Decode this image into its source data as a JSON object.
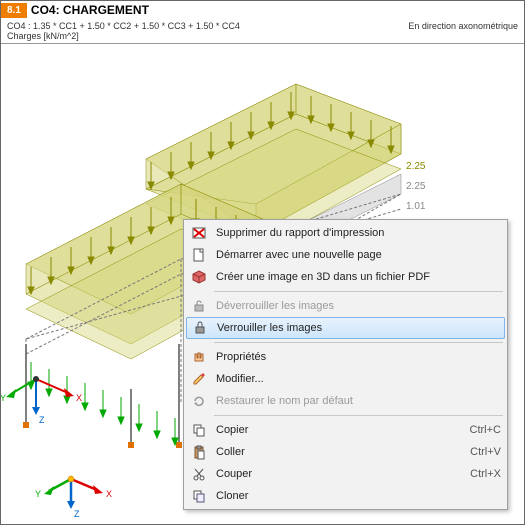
{
  "header": {
    "tag": "8.1",
    "title": "CO4: CHARGEMENT"
  },
  "subheader": {
    "formula": "CO4 : 1.35 * CC1 + 1.50 * CC2 + 1.50 * CC3 + 1.50 * CC4",
    "units": "Charges [kN/m^2]",
    "view_mode": "En direction axonométrique"
  },
  "loads": {
    "upper_right_1": "2.25",
    "upper_right_2": "2.25",
    "lower_right": "1.01"
  },
  "axis_large": {
    "x": "X",
    "y": "Y",
    "z": "Z"
  },
  "axis_small": {
    "x": "X",
    "y": "Y",
    "z": "Z"
  },
  "menu": {
    "delete_report": "Supprimer du rapport d'impression",
    "new_page": "Démarrer avec une nouvelle page",
    "create_3d_pdf": "Créer une image en 3D dans un fichier PDF",
    "unlock_images": "Déverrouiller les images",
    "lock_images": "Verrouiller les images",
    "properties": "Propriétés",
    "modify": "Modifier...",
    "restore_name": "Restaurer le nom par défaut",
    "copy": "Copier",
    "paste": "Coller",
    "cut": "Couper",
    "clone": "Cloner",
    "shortcut_copy": "Ctrl+C",
    "shortcut_paste": "Ctrl+V",
    "shortcut_cut": "Ctrl+X"
  },
  "icons": {
    "delete": "delete-icon",
    "page": "page-icon",
    "pdf3d": "cube-icon",
    "unlock": "unlock-icon",
    "lock": "lock-icon",
    "properties": "hand-icon",
    "modify": "pencil-icon",
    "restore": "refresh-icon",
    "copy": "copy-icon",
    "paste": "clipboard-icon",
    "cut": "scissors-icon",
    "clone": "clone-icon"
  }
}
